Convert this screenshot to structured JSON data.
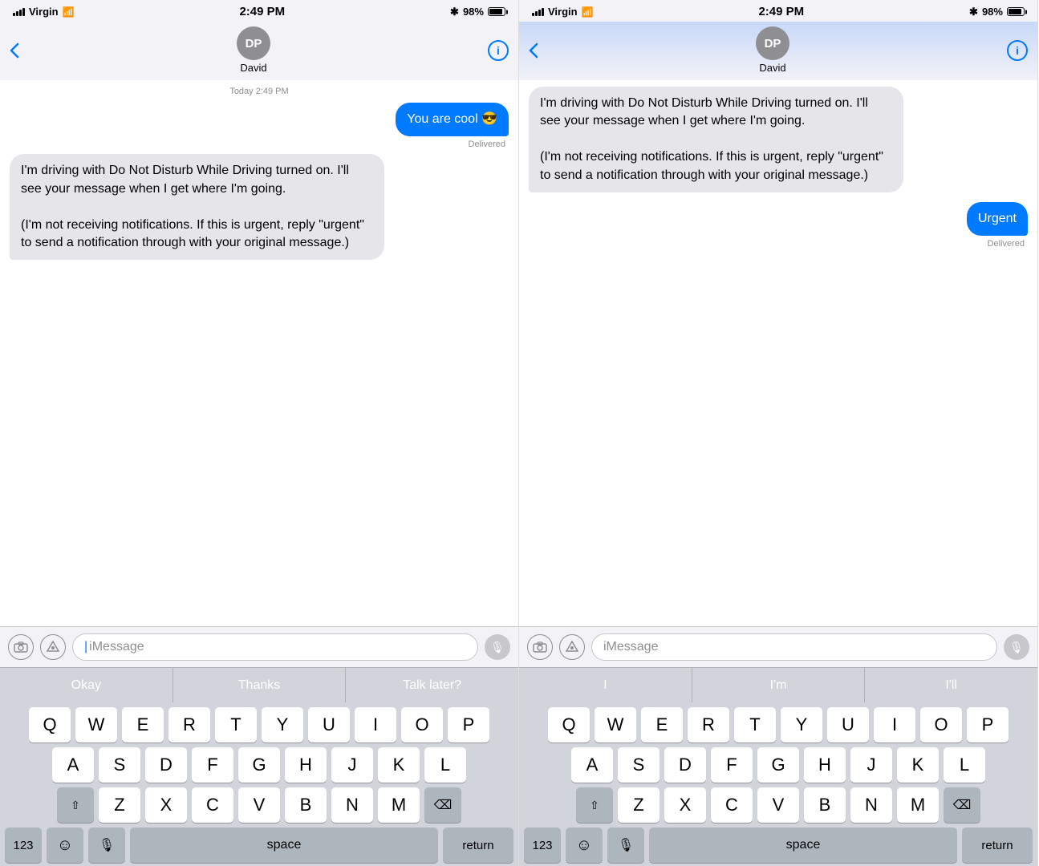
{
  "left": {
    "status": {
      "carrier": "Virgin",
      "time": "2:49 PM",
      "battery": "98%"
    },
    "nav": {
      "back": "<",
      "avatar": "DP",
      "name": "David",
      "info": "i"
    },
    "messages": [
      {
        "type": "timestamp",
        "text": "Today 2:49 PM"
      },
      {
        "type": "sent",
        "text": "You are cool 😎"
      },
      {
        "type": "delivered",
        "text": "Delivered"
      },
      {
        "type": "received",
        "text": "I'm driving with Do Not Disturb While Driving turned on. I'll see your message when I get where I'm going.\n\n(I'm not receiving notifications. If this is urgent, reply \"urgent\" to send a notification through with your original message.)"
      }
    ],
    "input": {
      "placeholder": "iMessage"
    },
    "predictive": [
      "Okay",
      "Thanks",
      "Talk later?"
    ],
    "keyboard": {
      "rows": [
        [
          "Q",
          "W",
          "E",
          "R",
          "T",
          "Y",
          "U",
          "I",
          "O",
          "P"
        ],
        [
          "A",
          "S",
          "D",
          "F",
          "G",
          "H",
          "J",
          "K",
          "L"
        ],
        [
          "⇧",
          "Z",
          "X",
          "C",
          "V",
          "B",
          "N",
          "M",
          "⌫"
        ],
        [
          "123",
          "☺",
          "🎙",
          "space",
          "return"
        ]
      ]
    }
  },
  "right": {
    "status": {
      "carrier": "Virgin",
      "time": "2:49 PM",
      "battery": "98%"
    },
    "nav": {
      "back": "<",
      "avatar": "DP",
      "name": "David",
      "info": "i"
    },
    "messages": [
      {
        "type": "received",
        "text": "I'm driving with Do Not Disturb While Driving turned on. I'll see your message when I get where I'm going.\n\n(I'm not receiving notifications. If this is urgent, reply \"urgent\" to send a notification through with your original message.)"
      },
      {
        "type": "sent",
        "text": "Urgent"
      },
      {
        "type": "delivered",
        "text": "Delivered"
      }
    ],
    "input": {
      "placeholder": "iMessage"
    },
    "predictive": [
      "I",
      "I'm",
      "I'll"
    ],
    "keyboard": {
      "rows": [
        [
          "Q",
          "W",
          "E",
          "R",
          "T",
          "Y",
          "U",
          "I",
          "O",
          "P"
        ],
        [
          "A",
          "S",
          "D",
          "F",
          "G",
          "H",
          "J",
          "K",
          "L"
        ],
        [
          "⇧",
          "Z",
          "X",
          "C",
          "V",
          "B",
          "N",
          "M",
          "⌫"
        ],
        [
          "123",
          "☺",
          "🎙",
          "space",
          "return"
        ]
      ]
    }
  }
}
